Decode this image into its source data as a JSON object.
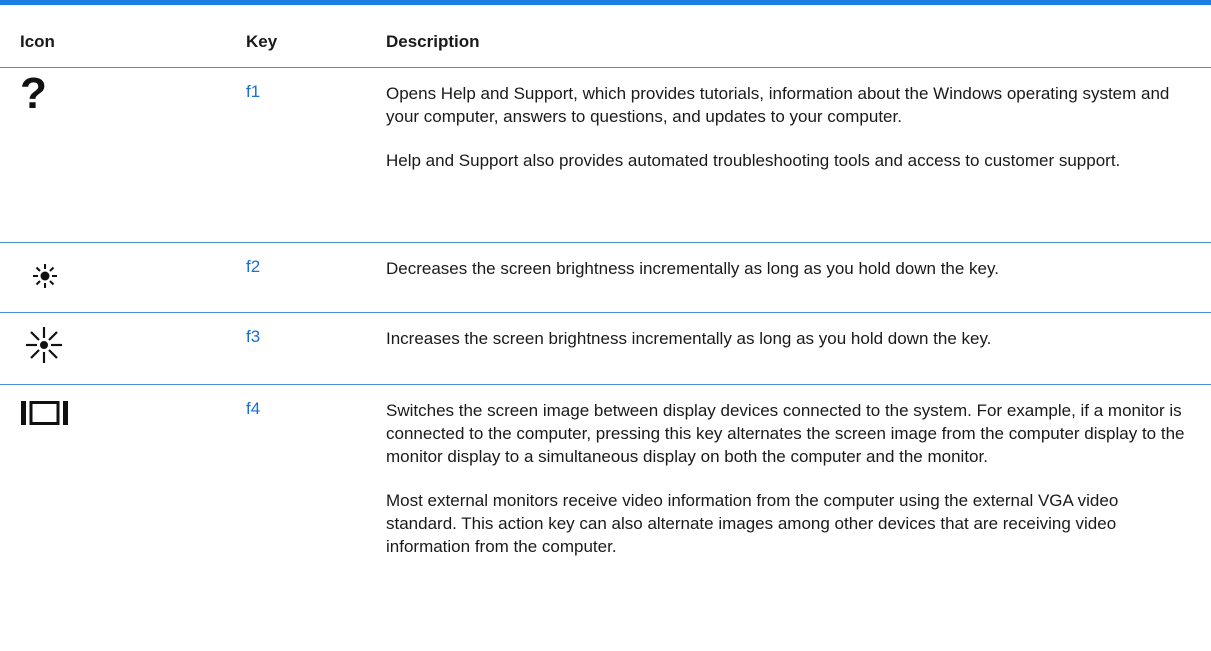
{
  "headers": {
    "icon": "Icon",
    "key": "Key",
    "description": "Description"
  },
  "rows": [
    {
      "icon": "question-mark-icon",
      "key": "f1",
      "desc1": "Opens Help and Support, which provides tutorials, information about the Windows operating system and your computer, answers to questions, and updates to your computer.",
      "desc2": "Help and Support also provides automated troubleshooting tools and access to customer support."
    },
    {
      "icon": "brightness-down-icon",
      "key": "f2",
      "desc1": "Decreases the screen brightness incrementally as long as you hold down the key."
    },
    {
      "icon": "brightness-up-icon",
      "key": "f3",
      "desc1": "Increases the screen brightness incrementally as long as you hold down the key."
    },
    {
      "icon": "switch-display-icon",
      "key": "f4",
      "desc1": "Switches the screen image between display devices connected to the system. For example, if a monitor is connected to the computer, pressing this key alternates the screen image from the computer display to the monitor display to a simultaneous display on both the computer and the monitor.",
      "desc2": "Most external monitors receive video information from the computer using the external VGA video standard. This action key can also alternate images among other devices that are receiving video information from the computer."
    }
  ],
  "colors": {
    "accent": "#1a7fe0",
    "rule": "#4a90d9",
    "key_link": "#1a6fd6"
  }
}
